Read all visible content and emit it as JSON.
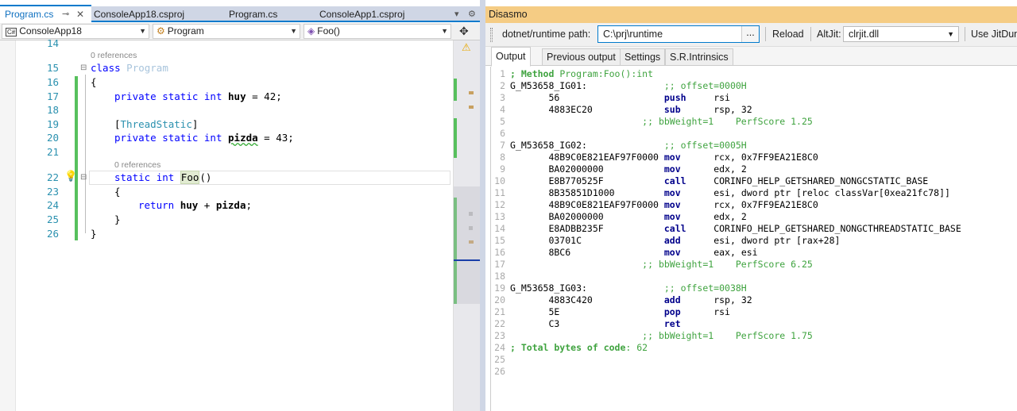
{
  "editor": {
    "tabs": [
      {
        "label": "Program.cs",
        "active": true
      },
      {
        "label": "ConsoleApp18.csproj"
      },
      {
        "label": "Program.cs"
      },
      {
        "label": "ConsoleApp1.csproj"
      }
    ],
    "pin_icon": "pin-icon",
    "close_icon": "close-icon",
    "nav": {
      "project": "ConsoleApp18",
      "class": "Program",
      "member": "Foo()",
      "project_icon": "csharp-project-icon",
      "class_icon": "class-icon",
      "member_icon": "method-icon"
    },
    "ref_label": "0 references",
    "lines": {
      "l14": "14",
      "l15": "15",
      "l16": "16",
      "l17": "17",
      "l18": "18",
      "l19": "19",
      "l20": "20",
      "l21": "21",
      "l22": "22",
      "l23": "23",
      "l24": "24",
      "l25": "25",
      "l26": "26"
    },
    "code": {
      "class_kw": "class",
      "class_name": "Program",
      "open_brace": "{",
      "close_brace": "}",
      "priv": "private",
      "stat": "static",
      "int": "int",
      "huy": "huy",
      "eq42": " = 42;",
      "thread_open": "[",
      "thread": "ThreadStatic",
      "thread_close": "]",
      "pizda": "pizda",
      "eq43": " = 43;",
      "foo": "Foo",
      "parens": "()",
      "ret": "return",
      "plus": " + ",
      "semi": ";"
    }
  },
  "disasmo": {
    "title": "Disasmo",
    "path_label": "dotnet/runtime path:",
    "path_value": "C:\\prj\\runtime",
    "browse_label": "...",
    "reload_label": "Reload",
    "altjit_label": "AltJit:",
    "altjit_value": "clrjit.dll",
    "jitdump_label": "Use JitDump",
    "tabs": [
      "Output",
      "Previous output",
      "Settings",
      "S.R.Intrinsics"
    ],
    "lines": [
      {
        "n": "1",
        "text": "; Method Program:Foo():int"
      },
      {
        "n": "2",
        "text": "G_M53658_IG01:              ;; offset=0000H"
      },
      {
        "n": "3",
        "text": "       56                   push     rsi"
      },
      {
        "n": "4",
        "text": "       4883EC20             sub      rsp, 32"
      },
      {
        "n": "5",
        "text": "                        ;; bbWeight=1    PerfScore 1.25"
      },
      {
        "n": "6",
        "text": ""
      },
      {
        "n": "7",
        "text": "G_M53658_IG02:              ;; offset=0005H"
      },
      {
        "n": "8",
        "text": "       48B9C0E821EAF97F0000 mov      rcx, 0x7FF9EA21E8C0"
      },
      {
        "n": "9",
        "text": "       BA02000000           mov      edx, 2"
      },
      {
        "n": "10",
        "text": "       E8B770525F           call     CORINFO_HELP_GETSHARED_NONGCSTATIC_BASE"
      },
      {
        "n": "11",
        "text": "       8B35851D1000         mov      esi, dword ptr [reloc classVar[0xea21fc78]]"
      },
      {
        "n": "12",
        "text": "       48B9C0E821EAF97F0000 mov      rcx, 0x7FF9EA21E8C0"
      },
      {
        "n": "13",
        "text": "       BA02000000           mov      edx, 2"
      },
      {
        "n": "14",
        "text": "       E8ADBB235F           call     CORINFO_HELP_GETSHARED_NONGCTHREADSTATIC_BASE"
      },
      {
        "n": "15",
        "text": "       03701C               add      esi, dword ptr [rax+28]"
      },
      {
        "n": "16",
        "text": "       8BC6                 mov      eax, esi"
      },
      {
        "n": "17",
        "text": "                        ;; bbWeight=1    PerfScore 6.25"
      },
      {
        "n": "18",
        "text": ""
      },
      {
        "n": "19",
        "text": "G_M53658_IG03:              ;; offset=0038H"
      },
      {
        "n": "20",
        "text": "       4883C420             add      rsp, 32"
      },
      {
        "n": "21",
        "text": "       5E                   pop      rsi"
      },
      {
        "n": "22",
        "text": "       C3                   ret"
      },
      {
        "n": "23",
        "text": "                        ;; bbWeight=1    PerfScore 1.75"
      },
      {
        "n": "24",
        "text": "; Total bytes of code: 62"
      },
      {
        "n": "25",
        "text": ""
      },
      {
        "n": "26",
        "text": ""
      }
    ]
  }
}
